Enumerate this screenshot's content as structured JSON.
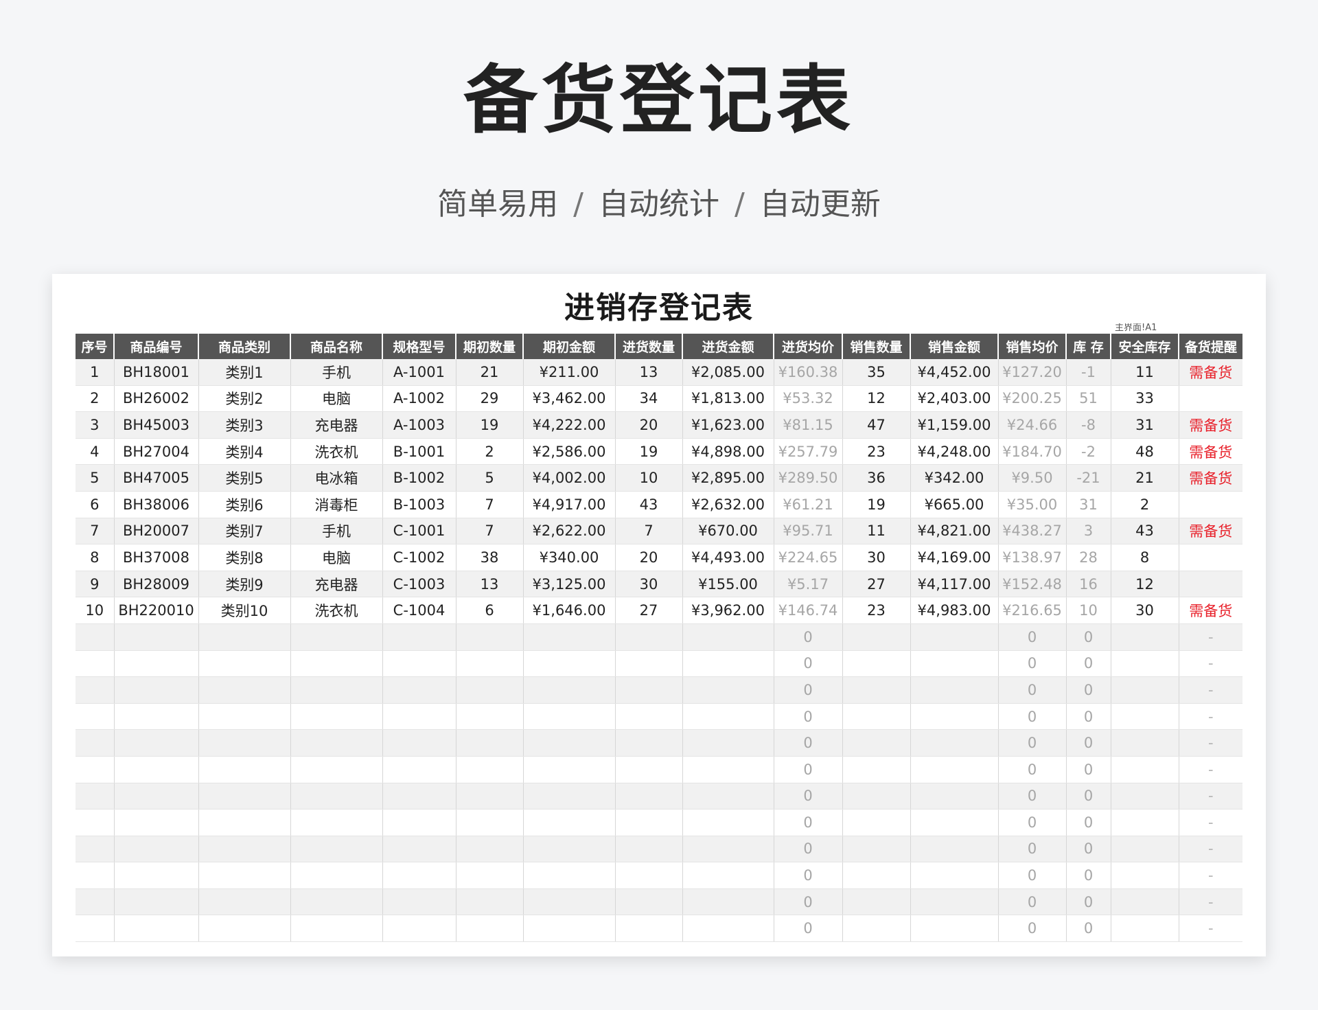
{
  "banner": {
    "title": "备货登记表",
    "subtitle": [
      "简单易用",
      "自动统计",
      "自动更新"
    ],
    "separator": "/"
  },
  "sheet": {
    "title": "进销存登记表",
    "link_text": "主界面!A1",
    "columns": [
      "序号",
      "商品编号",
      "商品类别",
      "商品名称",
      "规格型号",
      "期初数量",
      "期初金额",
      "进货数量",
      "进货金额",
      "进货均价",
      "销售数量",
      "销售金额",
      "销售均价",
      "库 存",
      "安全库存",
      "备货提醒"
    ],
    "rows": [
      [
        "1",
        "BH18001",
        "类别1",
        "手机",
        "A-1001",
        "21",
        "¥211.00",
        "13",
        "¥2,085.00",
        "¥160.38",
        "35",
        "¥4,452.00",
        "¥127.20",
        "-1",
        "11",
        "需备货"
      ],
      [
        "2",
        "BH26002",
        "类别2",
        "电脑",
        "A-1002",
        "29",
        "¥3,462.00",
        "34",
        "¥1,813.00",
        "¥53.32",
        "12",
        "¥2,403.00",
        "¥200.25",
        "51",
        "33",
        ""
      ],
      [
        "3",
        "BH45003",
        "类别3",
        "充电器",
        "A-1003",
        "19",
        "¥4,222.00",
        "20",
        "¥1,623.00",
        "¥81.15",
        "47",
        "¥1,159.00",
        "¥24.66",
        "-8",
        "31",
        "需备货"
      ],
      [
        "4",
        "BH27004",
        "类别4",
        "洗衣机",
        "B-1001",
        "2",
        "¥2,586.00",
        "19",
        "¥4,898.00",
        "¥257.79",
        "23",
        "¥4,248.00",
        "¥184.70",
        "-2",
        "48",
        "需备货"
      ],
      [
        "5",
        "BH47005",
        "类别5",
        "电冰箱",
        "B-1002",
        "5",
        "¥4,002.00",
        "10",
        "¥2,895.00",
        "¥289.50",
        "36",
        "¥342.00",
        "¥9.50",
        "-21",
        "21",
        "需备货"
      ],
      [
        "6",
        "BH38006",
        "类别6",
        "消毒柜",
        "B-1003",
        "7",
        "¥4,917.00",
        "43",
        "¥2,632.00",
        "¥61.21",
        "19",
        "¥665.00",
        "¥35.00",
        "31",
        "2",
        ""
      ],
      [
        "7",
        "BH20007",
        "类别7",
        "手机",
        "C-1001",
        "7",
        "¥2,622.00",
        "7",
        "¥670.00",
        "¥95.71",
        "11",
        "¥4,821.00",
        "¥438.27",
        "3",
        "43",
        "需备货"
      ],
      [
        "8",
        "BH37008",
        "类别8",
        "电脑",
        "C-1002",
        "38",
        "¥340.00",
        "20",
        "¥4,493.00",
        "¥224.65",
        "30",
        "¥4,169.00",
        "¥138.97",
        "28",
        "8",
        ""
      ],
      [
        "9",
        "BH28009",
        "类别9",
        "充电器",
        "C-1003",
        "13",
        "¥3,125.00",
        "30",
        "¥155.00",
        "¥5.17",
        "27",
        "¥4,117.00",
        "¥152.48",
        "16",
        "12",
        ""
      ],
      [
        "10",
        "BH220010",
        "类别10",
        "洗衣机",
        "C-1004",
        "6",
        "¥1,646.00",
        "27",
        "¥3,962.00",
        "¥146.74",
        "23",
        "¥4,983.00",
        "¥216.65",
        "10",
        "30",
        "需备货"
      ],
      [
        "",
        "",
        "",
        "",
        "",
        "",
        "",
        "",
        "",
        "0",
        "",
        "",
        "0",
        "0",
        "",
        "-"
      ],
      [
        "",
        "",
        "",
        "",
        "",
        "",
        "",
        "",
        "",
        "0",
        "",
        "",
        "0",
        "0",
        "",
        "-"
      ],
      [
        "",
        "",
        "",
        "",
        "",
        "",
        "",
        "",
        "",
        "0",
        "",
        "",
        "0",
        "0",
        "",
        "-"
      ],
      [
        "",
        "",
        "",
        "",
        "",
        "",
        "",
        "",
        "",
        "0",
        "",
        "",
        "0",
        "0",
        "",
        "-"
      ],
      [
        "",
        "",
        "",
        "",
        "",
        "",
        "",
        "",
        "",
        "0",
        "",
        "",
        "0",
        "0",
        "",
        "-"
      ],
      [
        "",
        "",
        "",
        "",
        "",
        "",
        "",
        "",
        "",
        "0",
        "",
        "",
        "0",
        "0",
        "",
        "-"
      ],
      [
        "",
        "",
        "",
        "",
        "",
        "",
        "",
        "",
        "",
        "0",
        "",
        "",
        "0",
        "0",
        "",
        "-"
      ],
      [
        "",
        "",
        "",
        "",
        "",
        "",
        "",
        "",
        "",
        "0",
        "",
        "",
        "0",
        "0",
        "",
        "-"
      ],
      [
        "",
        "",
        "",
        "",
        "",
        "",
        "",
        "",
        "",
        "0",
        "",
        "",
        "0",
        "0",
        "",
        "-"
      ],
      [
        "",
        "",
        "",
        "",
        "",
        "",
        "",
        "",
        "",
        "0",
        "",
        "",
        "0",
        "0",
        "",
        "-"
      ],
      [
        "",
        "",
        "",
        "",
        "",
        "",
        "",
        "",
        "",
        "0",
        "",
        "",
        "0",
        "0",
        "",
        "-"
      ],
      [
        "",
        "",
        "",
        "",
        "",
        "",
        "",
        "",
        "",
        "0",
        "",
        "",
        "0",
        "0",
        "",
        "-"
      ]
    ]
  },
  "colors": {
    "header_bg": "#555555",
    "stripe": "#f1f1f1",
    "alert": "#e8212b",
    "muted": "#a6a6a6"
  }
}
